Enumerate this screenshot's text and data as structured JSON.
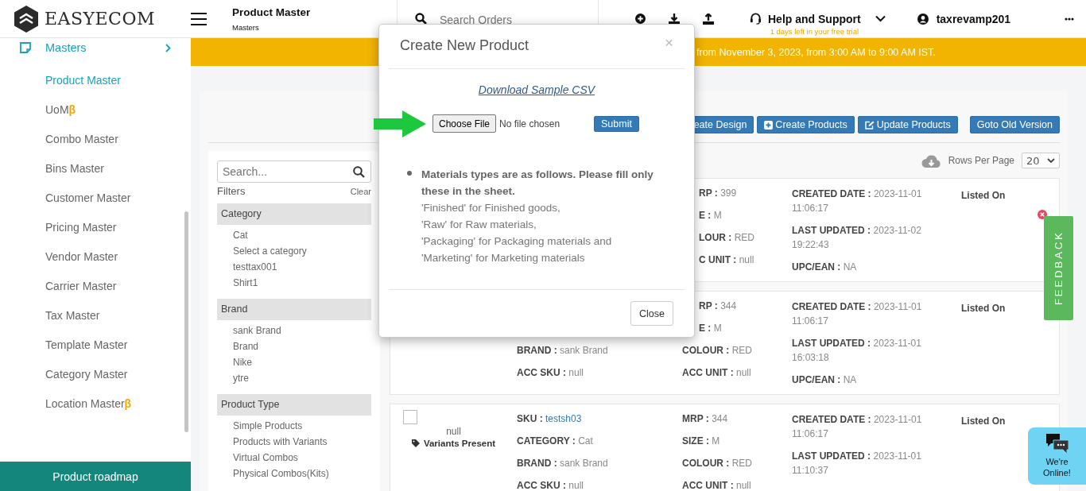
{
  "header": {
    "logo": "EASYECOM",
    "page_title": "Product Master",
    "breadcrumb": "Masters",
    "search": {
      "placeholder": "Search Orders"
    },
    "help": {
      "label": "Help and Support",
      "trial": "1 days left in your free trial"
    },
    "user": "taxrevamp201"
  },
  "sidebar": {
    "section": "Masters",
    "items": [
      {
        "label": "Product Master",
        "selected": true
      },
      {
        "label": "UoM",
        "badge": "β",
        "selected": false
      },
      {
        "label": "Combo Master",
        "selected": false
      },
      {
        "label": "Bins Master",
        "selected": false
      },
      {
        "label": "Customer Master",
        "selected": false
      },
      {
        "label": "Pricing Master",
        "selected": false
      },
      {
        "label": "Vendor Master",
        "selected": false
      },
      {
        "label": "Carrier Master",
        "selected": false
      },
      {
        "label": "Tax Master",
        "selected": false
      },
      {
        "label": "Template Master",
        "selected": false
      },
      {
        "label": "Category Master",
        "selected": false
      },
      {
        "label": "Location Master",
        "badge": "β",
        "selected": false
      }
    ],
    "footer_button": "Product roadmap"
  },
  "banner": "from November 3, 2023, from 3:00 AM to 9:00 AM IST.",
  "toolbar": [
    {
      "label": "eate Design",
      "kind": "plain"
    },
    {
      "label": "Create Products",
      "kind": "add"
    },
    {
      "label": "Update Products",
      "kind": "edit"
    },
    {
      "label": "Goto Old Version",
      "kind": "plain"
    }
  ],
  "rows_per_page": {
    "label": "Rows Per Page",
    "value": "20"
  },
  "filters": {
    "search_placeholder": "Search...",
    "title": "Filters",
    "clear": "Clear",
    "groups": [
      {
        "title": "Category",
        "options": [
          "Cat",
          "Select a category",
          "testtax001",
          "Shirt1"
        ]
      },
      {
        "title": "Brand",
        "options": [
          "sank Brand",
          "Brand",
          "Nike",
          "ytre"
        ]
      },
      {
        "title": "Product Type",
        "options": [
          "Simple Products",
          "Products with Variants",
          "Virtual Combos",
          "Physical Combos(Kits)"
        ]
      }
    ]
  },
  "products": [
    {
      "attributes": [
        {
          "label": "RP :",
          "value": "399",
          "cut": true
        },
        {
          "label": "E :",
          "value": "M",
          "cut": true
        },
        {
          "label": "LOUR :",
          "value": "RED",
          "cut": true
        },
        {
          "label": "C UNIT :",
          "value": "null",
          "cut": true
        }
      ],
      "dates": [
        {
          "label": "CREATED DATE :",
          "value": "2023-11-01 11:06:17"
        },
        {
          "label": "LAST UPDATED :",
          "value": "2023-11-02 19:22:43"
        },
        {
          "label": "UPC/EAN :",
          "value": "NA"
        }
      ],
      "listed": "Listed On",
      "close_badge": true
    },
    {
      "details": [
        {
          "label": "BRAND :",
          "value": "sank Brand",
          "link": false
        },
        {
          "label": "ACC SKU :",
          "value": "null",
          "link": false
        }
      ],
      "attributes": [
        {
          "label": "RP :",
          "value": "344",
          "cut": true
        },
        {
          "label": "E :",
          "value": "M",
          "cut": true
        },
        {
          "label": "COLOUR :",
          "value": "RED",
          "cut": false
        },
        {
          "label": "ACC UNIT :",
          "value": "null",
          "cut": false
        }
      ],
      "dates": [
        {
          "label": "CREATED DATE :",
          "value": "2023-11-01 11:06:17"
        },
        {
          "label": "LAST UPDATED :",
          "value": "2023-11-01 16:03:18"
        },
        {
          "label": "UPC/EAN :",
          "value": "NA"
        }
      ],
      "listed": "Listed On",
      "close_badge": false
    },
    {
      "checked": false,
      "image_caption": "null",
      "tag": "Variants Present",
      "details": [
        {
          "label": "SKU :",
          "value": "testsh03",
          "link": true
        },
        {
          "label": "CATEGORY :",
          "value": "Cat",
          "link": false
        },
        {
          "label": "BRAND :",
          "value": "sank Brand",
          "link": false
        },
        {
          "label": "ACC SKU :",
          "value": "null",
          "link": false
        }
      ],
      "attributes": [
        {
          "label": "MRP :",
          "value": "344",
          "cut": false
        },
        {
          "label": "SIZE :",
          "value": "M",
          "cut": false
        },
        {
          "label": "COLOUR :",
          "value": "RED",
          "cut": false
        },
        {
          "label": "ACC UNIT :",
          "value": "null",
          "cut": false
        }
      ],
      "dates": [
        {
          "label": "CREATED DATE :",
          "value": "2023-11-01 11:06:17"
        },
        {
          "label": "LAST UPDATED :",
          "value": "2023-11-01 11:10:37"
        }
      ],
      "listed": "Listed On",
      "close_badge": false
    }
  ],
  "modal": {
    "title": "Create New Product",
    "close_icon": "×",
    "link": "Download Sample CSV",
    "file_button": "Choose File",
    "file_status": "No file chosen",
    "submit": "Submit",
    "note": {
      "heading": "Materials types are as follows. Please fill only these in the sheet.",
      "lines": [
        "'Finished' for Finished goods,",
        "'Raw' for Raw materials,",
        "'Packaging' for Packaging materials and",
        "'Marketing' for Marketing materials"
      ]
    },
    "footer_button": "Close"
  },
  "feedback": "FEEDBACK",
  "chat": "We're Online!"
}
